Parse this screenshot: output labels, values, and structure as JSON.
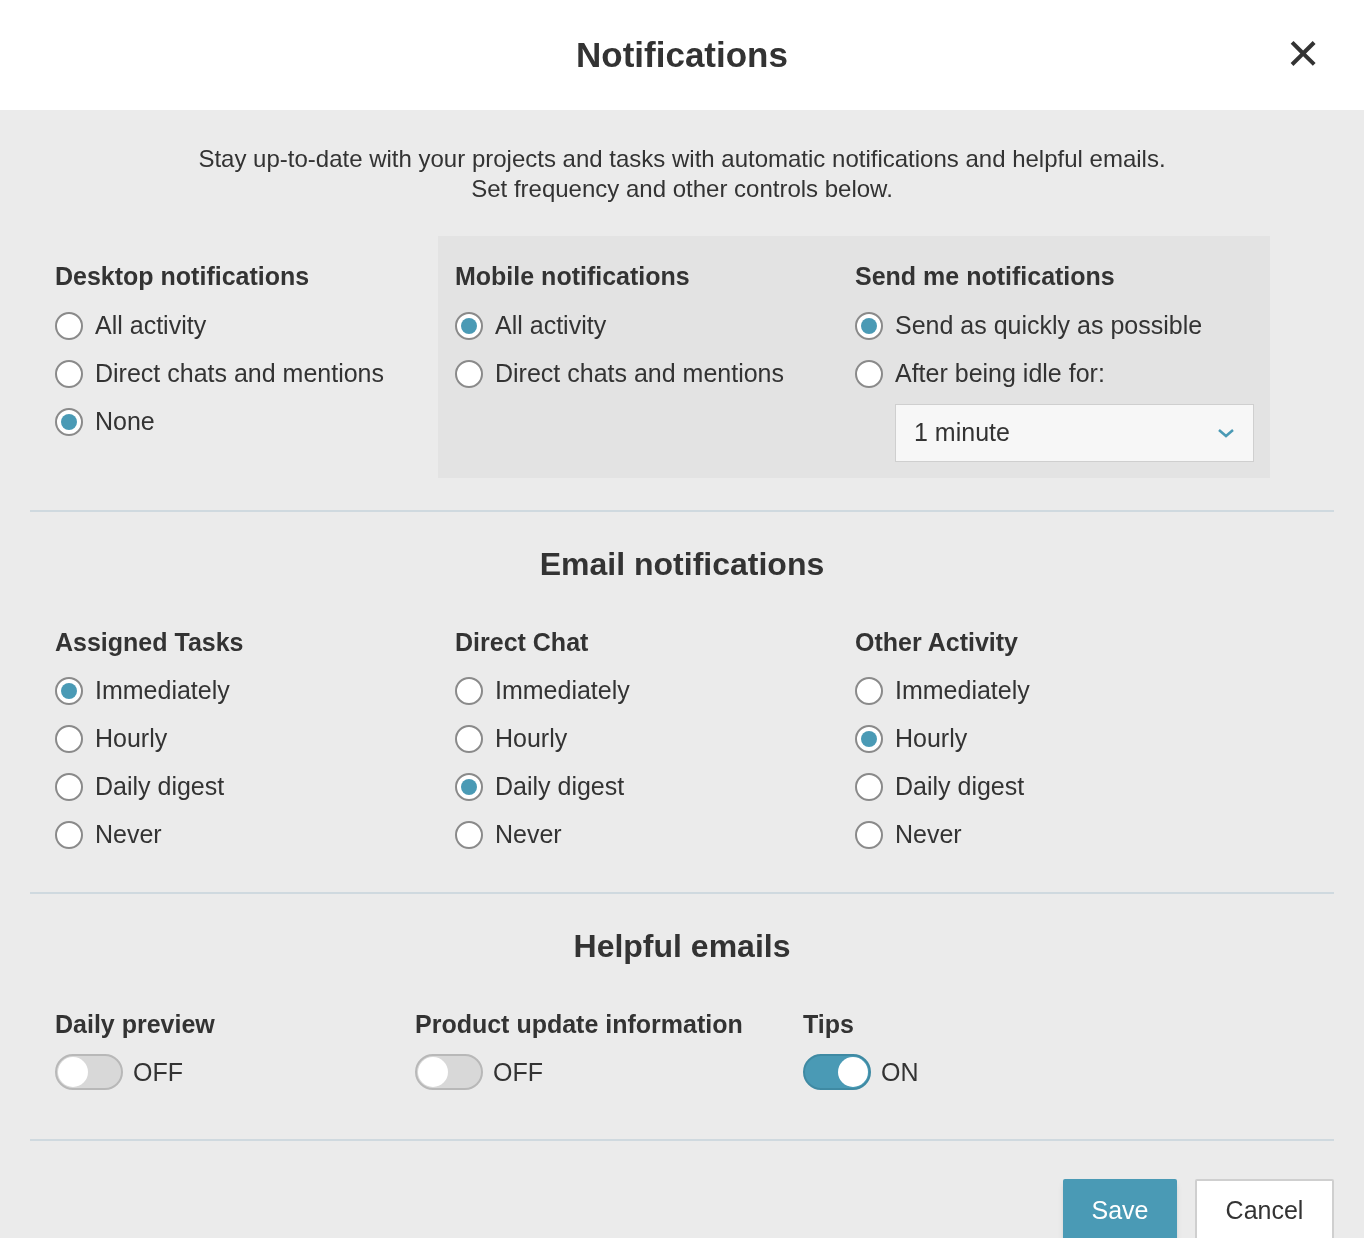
{
  "header": {
    "title": "Notifications",
    "close": "×"
  },
  "intro": [
    "Stay up-to-date with your projects and tasks with automatic notifications and helpful emails.",
    "Set frequency and other controls below."
  ],
  "desktop_group": {
    "heading": "Desktop notifications",
    "options": [
      {
        "label": "All activity",
        "selected": false
      },
      {
        "label": "Direct chats and mentions",
        "selected": false
      },
      {
        "label": "None",
        "selected": true
      }
    ]
  },
  "mobile_panel": {
    "groups": [
      {
        "heading": "Mobile notifications",
        "options": [
          {
            "label": "All activity",
            "selected": true
          },
          {
            "label": "Direct chats and mentions",
            "selected": false
          }
        ]
      },
      {
        "heading": "Send me notifications",
        "options": [
          {
            "label": "Send as quickly as possible",
            "selected": true
          },
          {
            "label": "After being idle for:",
            "selected": false
          }
        ],
        "dropdown": {
          "value": "1 minute"
        }
      }
    ]
  },
  "email": {
    "title": "Email notifications",
    "groups": [
      {
        "heading": "Assigned Tasks",
        "options": [
          {
            "label": "Immediately",
            "selected": true
          },
          {
            "label": "Hourly",
            "selected": false
          },
          {
            "label": "Daily digest",
            "selected": false
          },
          {
            "label": "Never",
            "selected": false
          }
        ]
      },
      {
        "heading": "Direct Chat",
        "options": [
          {
            "label": "Immediately",
            "selected": false
          },
          {
            "label": "Hourly",
            "selected": false
          },
          {
            "label": "Daily digest",
            "selected": true
          },
          {
            "label": "Never",
            "selected": false
          }
        ]
      },
      {
        "heading": "Other Activity",
        "options": [
          {
            "label": "Immediately",
            "selected": false
          },
          {
            "label": "Hourly",
            "selected": true
          },
          {
            "label": "Daily digest",
            "selected": false
          },
          {
            "label": "Never",
            "selected": false
          }
        ]
      }
    ]
  },
  "helpful": {
    "title": "Helpful emails",
    "toggles": [
      {
        "label": "Daily preview",
        "on": false,
        "state_text": "OFF"
      },
      {
        "label": "Product update information",
        "on": false,
        "state_text": "OFF"
      },
      {
        "label": "Tips",
        "on": true,
        "state_text": "ON"
      }
    ]
  },
  "buttons": [
    {
      "label": "Save",
      "kind": "primary"
    },
    {
      "label": "Cancel",
      "kind": "secondary"
    }
  ]
}
